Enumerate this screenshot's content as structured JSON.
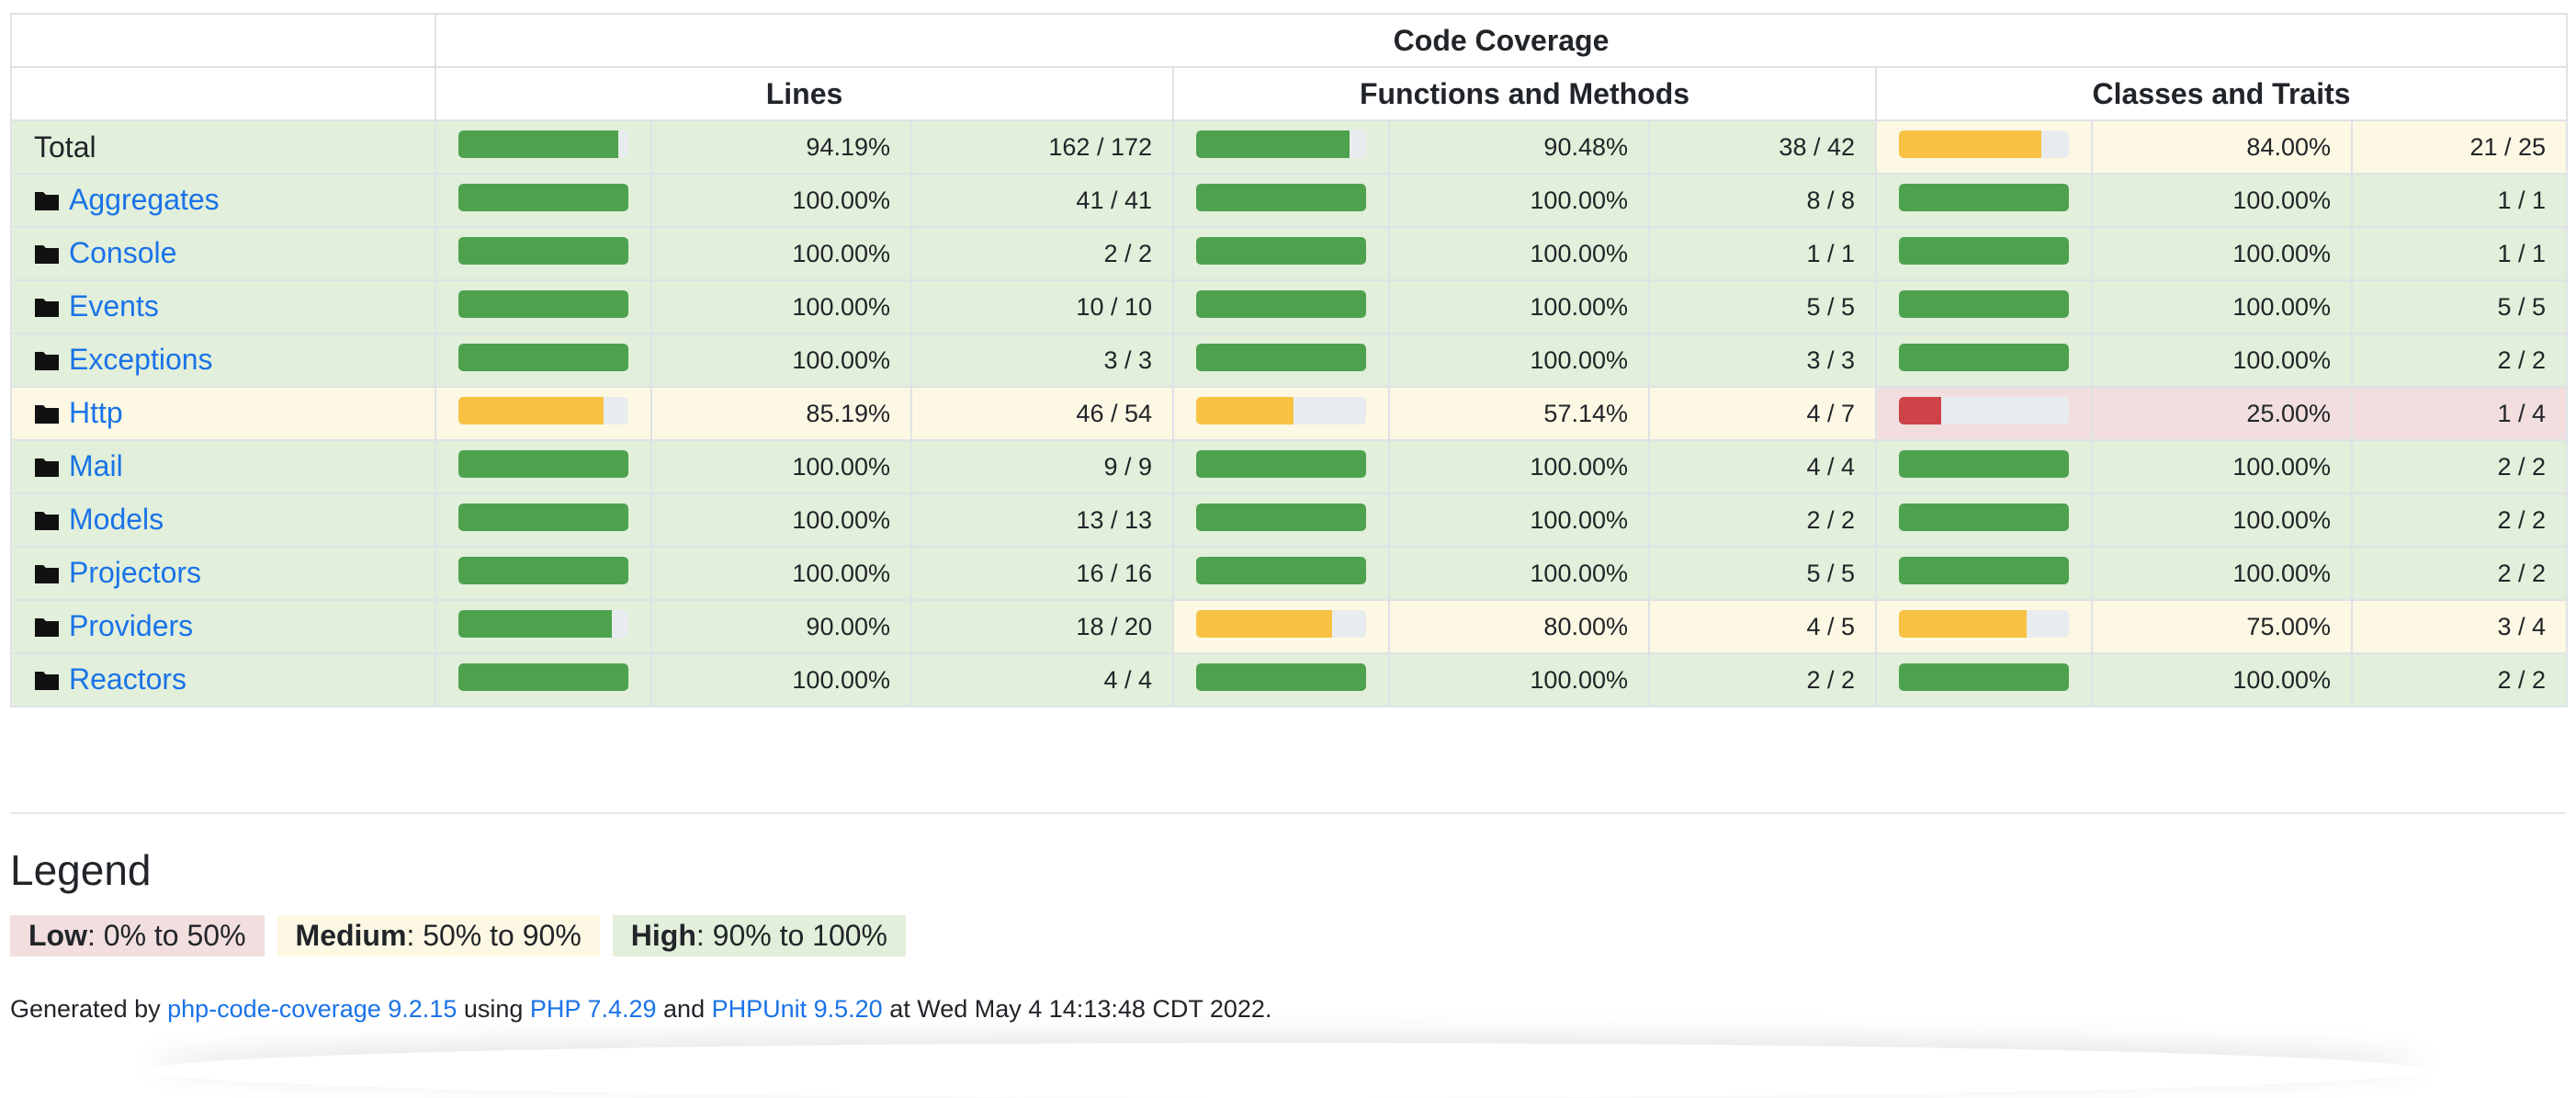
{
  "header": {
    "title": "Code Coverage",
    "lines": "Lines",
    "functions": "Functions and Methods",
    "classes": "Classes and Traits"
  },
  "rows": [
    {
      "name": "Total",
      "is_dir": false,
      "lines": {
        "pct": "94.19%",
        "ratio": "162 / 172",
        "value": 94.19,
        "level": "high"
      },
      "functions": {
        "pct": "90.48%",
        "ratio": "38 / 42",
        "value": 90.48,
        "level": "high"
      },
      "classes": {
        "pct": "84.00%",
        "ratio": "21 / 25",
        "value": 84.0,
        "level": "medium"
      }
    },
    {
      "name": "Aggregates",
      "is_dir": true,
      "lines": {
        "pct": "100.00%",
        "ratio": "41 / 41",
        "value": 100,
        "level": "high"
      },
      "functions": {
        "pct": "100.00%",
        "ratio": "8 / 8",
        "value": 100,
        "level": "high"
      },
      "classes": {
        "pct": "100.00%",
        "ratio": "1 / 1",
        "value": 100,
        "level": "high"
      }
    },
    {
      "name": "Console",
      "is_dir": true,
      "lines": {
        "pct": "100.00%",
        "ratio": "2 / 2",
        "value": 100,
        "level": "high"
      },
      "functions": {
        "pct": "100.00%",
        "ratio": "1 / 1",
        "value": 100,
        "level": "high"
      },
      "classes": {
        "pct": "100.00%",
        "ratio": "1 / 1",
        "value": 100,
        "level": "high"
      }
    },
    {
      "name": "Events",
      "is_dir": true,
      "lines": {
        "pct": "100.00%",
        "ratio": "10 / 10",
        "value": 100,
        "level": "high"
      },
      "functions": {
        "pct": "100.00%",
        "ratio": "5 / 5",
        "value": 100,
        "level": "high"
      },
      "classes": {
        "pct": "100.00%",
        "ratio": "5 / 5",
        "value": 100,
        "level": "high"
      }
    },
    {
      "name": "Exceptions",
      "is_dir": true,
      "lines": {
        "pct": "100.00%",
        "ratio": "3 / 3",
        "value": 100,
        "level": "high"
      },
      "functions": {
        "pct": "100.00%",
        "ratio": "3 / 3",
        "value": 100,
        "level": "high"
      },
      "classes": {
        "pct": "100.00%",
        "ratio": "2 / 2",
        "value": 100,
        "level": "high"
      }
    },
    {
      "name": "Http",
      "is_dir": true,
      "lines": {
        "pct": "85.19%",
        "ratio": "46 / 54",
        "value": 85.19,
        "level": "medium"
      },
      "functions": {
        "pct": "57.14%",
        "ratio": "4 / 7",
        "value": 57.14,
        "level": "medium"
      },
      "classes": {
        "pct": "25.00%",
        "ratio": "1 / 4",
        "value": 25.0,
        "level": "low"
      }
    },
    {
      "name": "Mail",
      "is_dir": true,
      "lines": {
        "pct": "100.00%",
        "ratio": "9 / 9",
        "value": 100,
        "level": "high"
      },
      "functions": {
        "pct": "100.00%",
        "ratio": "4 / 4",
        "value": 100,
        "level": "high"
      },
      "classes": {
        "pct": "100.00%",
        "ratio": "2 / 2",
        "value": 100,
        "level": "high"
      }
    },
    {
      "name": "Models",
      "is_dir": true,
      "lines": {
        "pct": "100.00%",
        "ratio": "13 / 13",
        "value": 100,
        "level": "high"
      },
      "functions": {
        "pct": "100.00%",
        "ratio": "2 / 2",
        "value": 100,
        "level": "high"
      },
      "classes": {
        "pct": "100.00%",
        "ratio": "2 / 2",
        "value": 100,
        "level": "high"
      }
    },
    {
      "name": "Projectors",
      "is_dir": true,
      "lines": {
        "pct": "100.00%",
        "ratio": "16 / 16",
        "value": 100,
        "level": "high"
      },
      "functions": {
        "pct": "100.00%",
        "ratio": "5 / 5",
        "value": 100,
        "level": "high"
      },
      "classes": {
        "pct": "100.00%",
        "ratio": "2 / 2",
        "value": 100,
        "level": "high"
      }
    },
    {
      "name": "Providers",
      "is_dir": true,
      "lines": {
        "pct": "90.00%",
        "ratio": "18 / 20",
        "value": 90.0,
        "level": "high"
      },
      "functions": {
        "pct": "80.00%",
        "ratio": "4 / 5",
        "value": 80.0,
        "level": "medium"
      },
      "classes": {
        "pct": "75.00%",
        "ratio": "3 / 4",
        "value": 75.0,
        "level": "medium"
      }
    },
    {
      "name": "Reactors",
      "is_dir": true,
      "lines": {
        "pct": "100.00%",
        "ratio": "4 / 4",
        "value": 100,
        "level": "high"
      },
      "functions": {
        "pct": "100.00%",
        "ratio": "2 / 2",
        "value": 100,
        "level": "high"
      },
      "classes": {
        "pct": "100.00%",
        "ratio": "2 / 2",
        "value": 100,
        "level": "high"
      }
    }
  ],
  "legend": {
    "title": "Legend",
    "low_label": "Low",
    "low_range": ": 0% to 50%",
    "medium_label": "Medium",
    "medium_range": ": 50% to 90%",
    "high_label": "High",
    "high_range": ": 90% to 100%"
  },
  "footer": {
    "prefix": "Generated by ",
    "tool_link": "php-code-coverage 9.2.15",
    "using": " using ",
    "php_link": "PHP 7.4.29",
    "and": " and ",
    "phpunit_link": "PHPUnit 9.5.20",
    "suffix": " at Wed May 4 14:13:48 CDT 2022."
  },
  "colors": {
    "high_bg": "#e2efda",
    "medium_bg": "#fcf8e3",
    "low_bg": "#f2dede",
    "high_bar": "#4ea24e",
    "medium_bar": "#f7c244",
    "low_bar": "#cd4348",
    "link": "#1a73e8"
  },
  "icons": {
    "directory": "folder-icon"
  }
}
